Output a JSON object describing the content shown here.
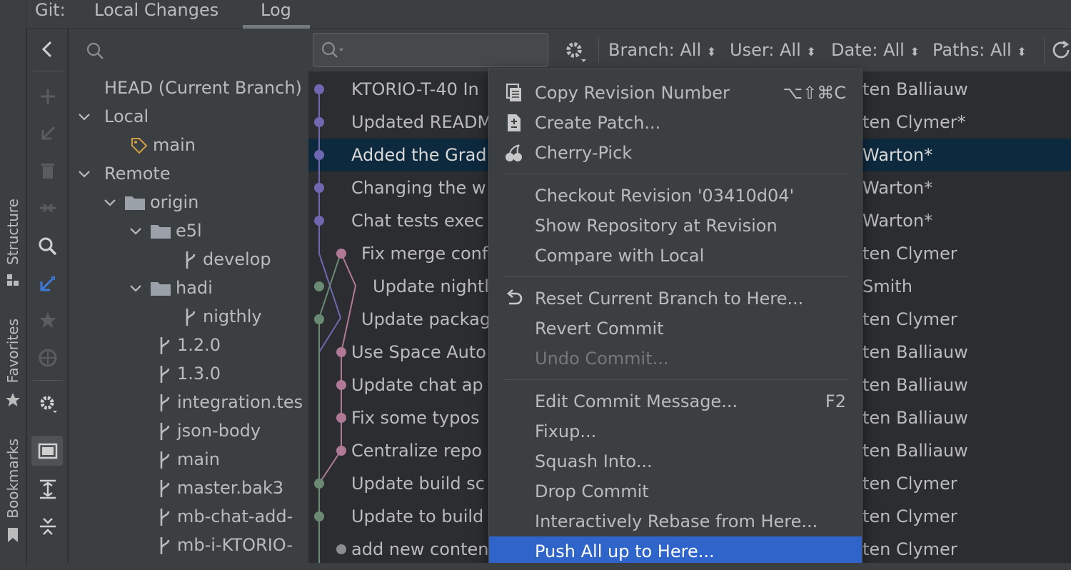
{
  "side_stripe": {
    "labels": [
      "Structure",
      "Favorites",
      "Bookmarks"
    ]
  },
  "topbar": {
    "title": "Git:",
    "tabs": [
      {
        "label": "Local Changes"
      },
      {
        "label": "Log",
        "active": true
      }
    ]
  },
  "toolbar": {
    "icons": [
      "back-arrow-icon",
      "add-icon",
      "fetch-icon",
      "delete-icon",
      "merge-icon",
      "search-icon",
      "update-icon",
      "favorite-icon",
      "target-icon",
      "settings-icon",
      "group-icon",
      "expand-all-icon",
      "collapse-all-icon"
    ]
  },
  "tree": {
    "search_placeholder": "",
    "items": [
      {
        "label": "HEAD (Current Branch)",
        "icon": "none",
        "level": 0
      },
      {
        "label": "Local",
        "icon": "chevron-down-icon",
        "level": 0
      },
      {
        "label": "main",
        "icon": "tag-icon",
        "level": 1
      },
      {
        "label": "Remote",
        "icon": "chevron-down-icon",
        "level": 0
      },
      {
        "label": "origin",
        "icon": "folder-icon",
        "level": 1
      },
      {
        "label": "e5l",
        "icon": "folder-icon",
        "level": 2
      },
      {
        "label": "develop",
        "icon": "branch-icon",
        "level": 3
      },
      {
        "label": "hadi",
        "icon": "folder-icon",
        "level": 2
      },
      {
        "label": "nigthly",
        "icon": "branch-icon",
        "level": 3
      },
      {
        "label": "1.2.0",
        "icon": "branch-icon",
        "level": 2
      },
      {
        "label": "1.3.0",
        "icon": "branch-icon",
        "level": 2
      },
      {
        "label": "integration.tes",
        "icon": "branch-icon",
        "level": 2
      },
      {
        "label": "json-body",
        "icon": "branch-icon",
        "level": 2
      },
      {
        "label": "main",
        "icon": "branch-icon",
        "level": 2
      },
      {
        "label": "master.bak3",
        "icon": "branch-icon",
        "level": 2
      },
      {
        "label": "mb-chat-add-",
        "icon": "branch-icon",
        "level": 2
      },
      {
        "label": "mb-i-KTORIO-",
        "icon": "branch-icon",
        "level": 2
      }
    ]
  },
  "log": {
    "search_value": "",
    "filters": [
      {
        "label": "Branch: All"
      },
      {
        "label": "User: All"
      },
      {
        "label": "Date: All"
      },
      {
        "label": "Paths: All"
      }
    ],
    "commits": [
      {
        "message": "KTORIO-T-40 In",
        "author": "ten Balliauw",
        "selected": false
      },
      {
        "message": "Updated READM",
        "author": "ten Clymer*",
        "selected": false
      },
      {
        "message": "Added the Grad",
        "author": "Warton*",
        "selected": true
      },
      {
        "message": "Changing the w",
        "author": "Warton*",
        "selected": false
      },
      {
        "message": "Chat tests exec",
        "author": "Warton*",
        "selected": false
      },
      {
        "message": "Fix merge conf",
        "author": "ten Clymer",
        "selected": false
      },
      {
        "message": "Update nightl",
        "author": "Smith",
        "selected": false
      },
      {
        "message": "Update package",
        "author": "ten Clymer",
        "selected": false
      },
      {
        "message": "Use Space Auto",
        "author": "ten Balliauw",
        "selected": false
      },
      {
        "message": "Update chat ap",
        "author": "ten Balliauw",
        "selected": false
      },
      {
        "message": "Fix some typos",
        "author": "ten Balliauw",
        "selected": false
      },
      {
        "message": "Centralize repo",
        "author": "ten Balliauw",
        "selected": false
      },
      {
        "message": "Update build sc",
        "author": "ten Clymer",
        "selected": false
      },
      {
        "message": "Update to build",
        "author": "ten Clymer",
        "selected": false
      },
      {
        "message": "add new conten",
        "author": "ten Clymer",
        "selected": false
      }
    ]
  },
  "context_menu": {
    "items": [
      {
        "label": "Copy Revision Number",
        "shortcut": "⌥⇧⌘C",
        "icon": "copy-icon"
      },
      {
        "label": "Create Patch...",
        "shortcut": "",
        "icon": "patch-icon"
      },
      {
        "label": "Cherry-Pick",
        "shortcut": "",
        "icon": "cherry-icon"
      },
      {
        "label": "Checkout Revision '03410d04'",
        "shortcut": "",
        "icon": ""
      },
      {
        "label": "Show Repository at Revision",
        "shortcut": "",
        "icon": ""
      },
      {
        "label": "Compare with Local",
        "shortcut": "",
        "icon": ""
      },
      {
        "label": "Reset Current Branch to Here...",
        "shortcut": "",
        "icon": "reset-icon"
      },
      {
        "label": "Revert Commit",
        "shortcut": "",
        "icon": ""
      },
      {
        "label": "Undo Commit...",
        "shortcut": "",
        "icon": "",
        "disabled": true
      },
      {
        "label": "Edit Commit Message...",
        "shortcut": "F2",
        "icon": ""
      },
      {
        "label": "Fixup...",
        "shortcut": "",
        "icon": ""
      },
      {
        "label": "Squash Into...",
        "shortcut": "",
        "icon": ""
      },
      {
        "label": "Drop Commit",
        "shortcut": "",
        "icon": ""
      },
      {
        "label": "Interactively Rebase from Here...",
        "shortcut": "",
        "icon": ""
      },
      {
        "label": "Push All up to Here...",
        "shortcut": "",
        "icon": "",
        "active": true
      }
    ]
  },
  "colors": {
    "background": "#2b2d30",
    "panel": "#3c3f41",
    "selection": "#0d293e",
    "menu_highlight": "#2f65ca",
    "graph_purple": "#6f68b0",
    "graph_pink": "#b07a96",
    "graph_green": "#6a8a74",
    "text": "#bbbbbb"
  }
}
